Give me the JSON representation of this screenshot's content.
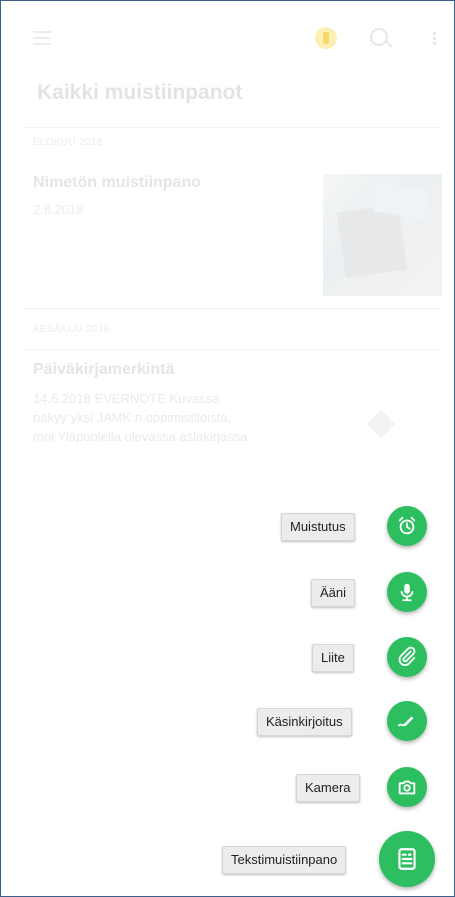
{
  "app": {
    "title": "Kaikki muistiinpanot"
  },
  "sections": [
    {
      "label": "ELOKUU 2018",
      "note": {
        "title": "Nimetön muistiinpano",
        "date": "2.8.2018"
      }
    },
    {
      "label": "KESÄKUU 2018",
      "note": {
        "title": "Päiväkirjamerkintä",
        "snippet_lines": [
          "14.6.2018 EVERNOTE Kuvassa",
          "näkyy yksi JAMK:n oppimistiloista,",
          "moi Yläpuolella olevassa asiakirjassa"
        ]
      }
    }
  ],
  "fab_menu": [
    {
      "label": "Muistutus",
      "icon": "alarm-clock-icon"
    },
    {
      "label": "Ääni",
      "icon": "microphone-icon"
    },
    {
      "label": "Liite",
      "icon": "paperclip-icon"
    },
    {
      "label": "Käsinkirjoitus",
      "icon": "handwriting-pen-icon"
    },
    {
      "label": "Kamera",
      "icon": "camera-icon"
    },
    {
      "label": "Tekstimuistiinpano",
      "icon": "text-note-icon"
    }
  ],
  "colors": {
    "accent": "#2dbe60",
    "sync": "#f7d767"
  }
}
